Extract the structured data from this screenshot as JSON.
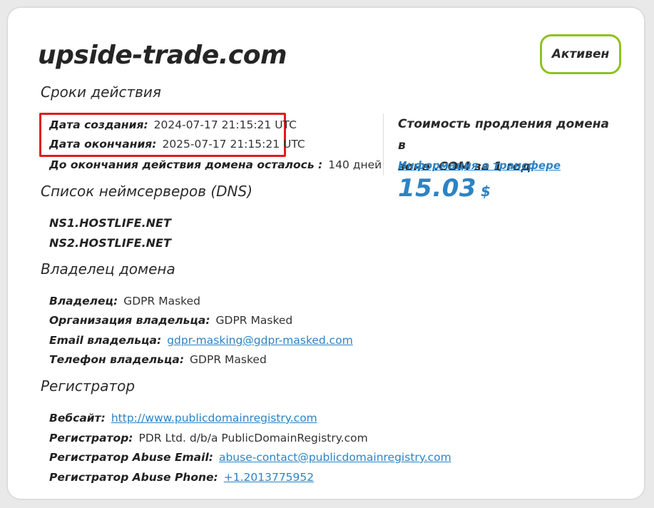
{
  "domain": "upside-trade.com",
  "status": "Активен",
  "validity": {
    "title": "Сроки действия",
    "created_label": "Дата создания:",
    "created_value": "2024-07-17 21:15:21 UTC",
    "expires_label": "Дата окончания:",
    "expires_value": "2025-07-17 21:15:21 UTC",
    "remaining_label": "До окончания действия домена осталось :",
    "remaining_value": "140 дней"
  },
  "renewal": {
    "text_line1": "Стоимость продления домена в",
    "text_line2": "зоне .COM за 1 год",
    "price": "15.03",
    "currency": "$",
    "transfer_link": "Информация о трансфере"
  },
  "dns": {
    "title": "Список неймсерверов (DNS)",
    "servers": [
      "NS1.HOSTLIFE.NET",
      "NS2.HOSTLIFE.NET"
    ]
  },
  "owner": {
    "title": "Владелец домена",
    "owner_label": "Владелец:",
    "owner_value": "GDPR Masked",
    "org_label": "Организация владельца:",
    "org_value": "GDPR Masked",
    "email_label": "Email владельца:",
    "email_value": "gdpr-masking@gdpr-masked.com",
    "phone_label": "Телефон владельца:",
    "phone_value": "GDPR Masked"
  },
  "registrar": {
    "title": "Регистратор",
    "website_label": "Вебсайт:",
    "website_value": "http://www.publicdomainregistry.com",
    "registrar_label": "Регистратор:",
    "registrar_value": "PDR Ltd. d/b/a PublicDomainRegistry.com",
    "abuse_email_label": "Регистратор Abuse Email:",
    "abuse_email_value": "abuse-contact@publicdomainregistry.com",
    "abuse_phone_label": "Регистратор Abuse Phone:",
    "abuse_phone_value": "+1.2013775952"
  },
  "colors": {
    "accent": "#2e83c3",
    "status_border": "#8dc21f",
    "highlight": "#e11b1b"
  }
}
